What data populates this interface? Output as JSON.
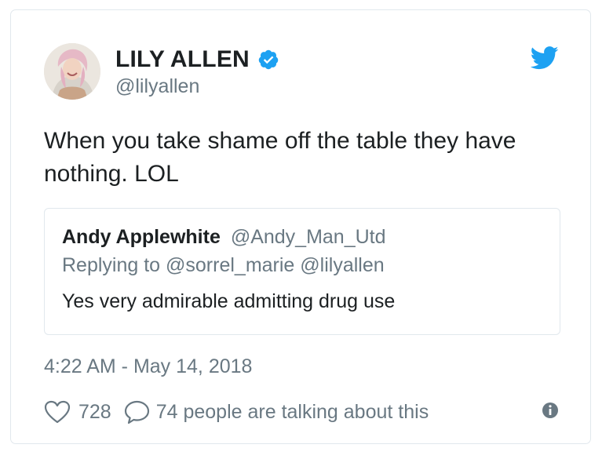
{
  "colors": {
    "text": "#1c2022",
    "secondary": "#697882",
    "border": "#e1e8ed",
    "twitter_blue": "#1da1f2"
  },
  "header": {
    "display_name": "LILY ALLEN",
    "handle": "@lilyallen",
    "verified_icon": "verified-badge-icon",
    "brand_icon": "twitter-bird-icon",
    "avatar": "avatar"
  },
  "tweet": {
    "text": "When you take shame off the table they have nothing. LOL"
  },
  "quote": {
    "name": "Andy Applewhite",
    "handle": "@Andy_Man_Utd",
    "replying_to": "Replying to @sorrel_marie @lilyallen",
    "text": "Yes very admirable admitting drug use"
  },
  "meta": {
    "timestamp": "4:22 AM - May 14, 2018"
  },
  "actions": {
    "like_icon": "heart-icon",
    "like_count": "728",
    "reply_icon": "speech-bubble-icon",
    "talking": "74 people are talking about this",
    "info_icon": "info-icon"
  }
}
